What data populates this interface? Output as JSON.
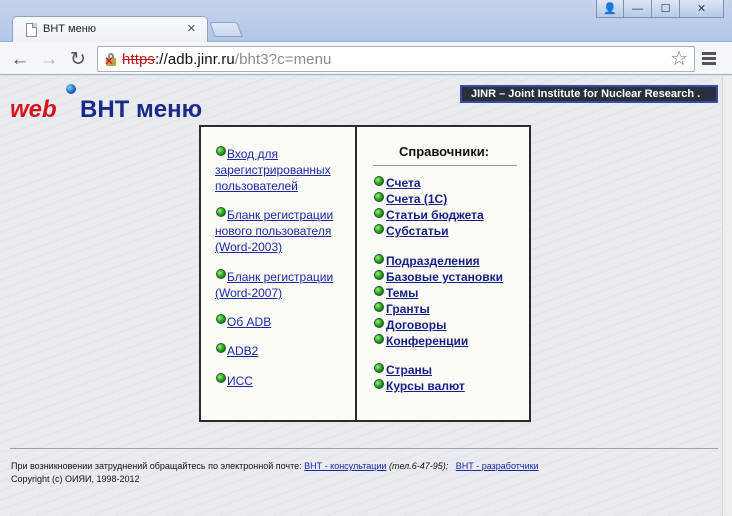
{
  "browser": {
    "tab_title": "ВНТ меню",
    "tab_close": "×",
    "url_scheme": "https",
    "url_host": "://adb.jinr.ru",
    "url_path": "/bht3?c=menu",
    "window_buttons": {
      "user": "👤",
      "minimize": "—",
      "maximize": "☐",
      "close": "✕"
    },
    "nav": {
      "back": "←",
      "forward": "→",
      "reload": "↻",
      "star": "☆"
    }
  },
  "header": {
    "logo": "web",
    "title": "ВНТ меню",
    "banner": "JINR – Joint Institute for Nuclear Research ."
  },
  "left_menu": [
    {
      "label": " Вход для зарегистрированных пользователей"
    },
    {
      "label": "Бланк регистрации нового пользователя (Word-2003)"
    },
    {
      "label": "Бланк регистрации (Word-2007)"
    },
    {
      "label": " Об ADB"
    },
    {
      "label": " ADB2"
    },
    {
      "label": " ИСС "
    }
  ],
  "right_menu": {
    "title": "Справочники:",
    "group1": [
      "Счета",
      "Счета (1С)",
      "Статьи бюджета",
      "Субстатьи"
    ],
    "group2": [
      "Подразделения",
      "Базовые установки",
      "Темы",
      "Гранты",
      "Договоры",
      "Конференции"
    ],
    "group3": [
      "Страны",
      "Курсы валют"
    ]
  },
  "footer": {
    "text1": "При возникновении затруднений обращайтесь по электронной почте: ",
    "link1": "ВНТ - консультации",
    "tel": " (тел.6-47-95);",
    "link2": "ВНТ - разработчики",
    "copyright": "Copyright (c) ОИЯИ, 1998-2012"
  },
  "colors": {
    "logo": "#d2141c",
    "title": "#1a2a88",
    "link": "#1a28a8",
    "banner_bg": "#2a2f3f",
    "bullet": "#1f9a1f"
  }
}
